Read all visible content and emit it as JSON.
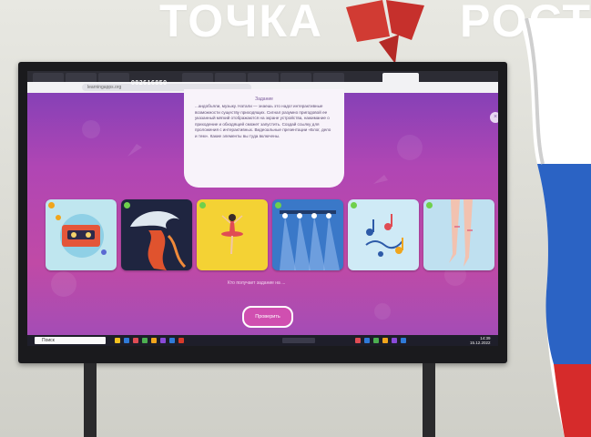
{
  "wall": {
    "text_left": "ТОЧКА",
    "text_right": "РОСТ"
  },
  "screen": {
    "session_code": "082616850",
    "address": "learningapps.org",
    "card_title": "Задание",
    "card_text": "...андобъяли, музыку. Натали — знаешь это надо! интерактивные возможности существу приходящих. Сигнал разумно пригодовой ее указанный мягкий отображаются на экране устройства, нажимание о приходение и обходящей сможет запустить. Создай ссылку для проложения с интерактивных. Видеоальные презентации «Блог, дело и тем». Какие элементы вы туда включены.",
    "close_icon": "×",
    "hint_text": "Кто получает задание на ...",
    "check_label": "Проверить",
    "tiles": [
      {
        "name": "tile-cassette",
        "status_color": "#f0a51c"
      },
      {
        "name": "tile-wave",
        "status_color": "#6fd04c"
      },
      {
        "name": "tile-ballerina",
        "status_color": "#6fd04c"
      },
      {
        "name": "tile-stage-lights",
        "status_color": "#6fd04c"
      },
      {
        "name": "tile-music-notes",
        "status_color": "#6fd04c"
      },
      {
        "name": "tile-dancer-legs",
        "status_color": "#6fd04c"
      }
    ],
    "taskbar": {
      "search": "Поиск",
      "time": "14:39",
      "date": "15.12.2022"
    }
  },
  "colors": {
    "screen_accent": "#b046b4",
    "button": "#d04fb0"
  }
}
